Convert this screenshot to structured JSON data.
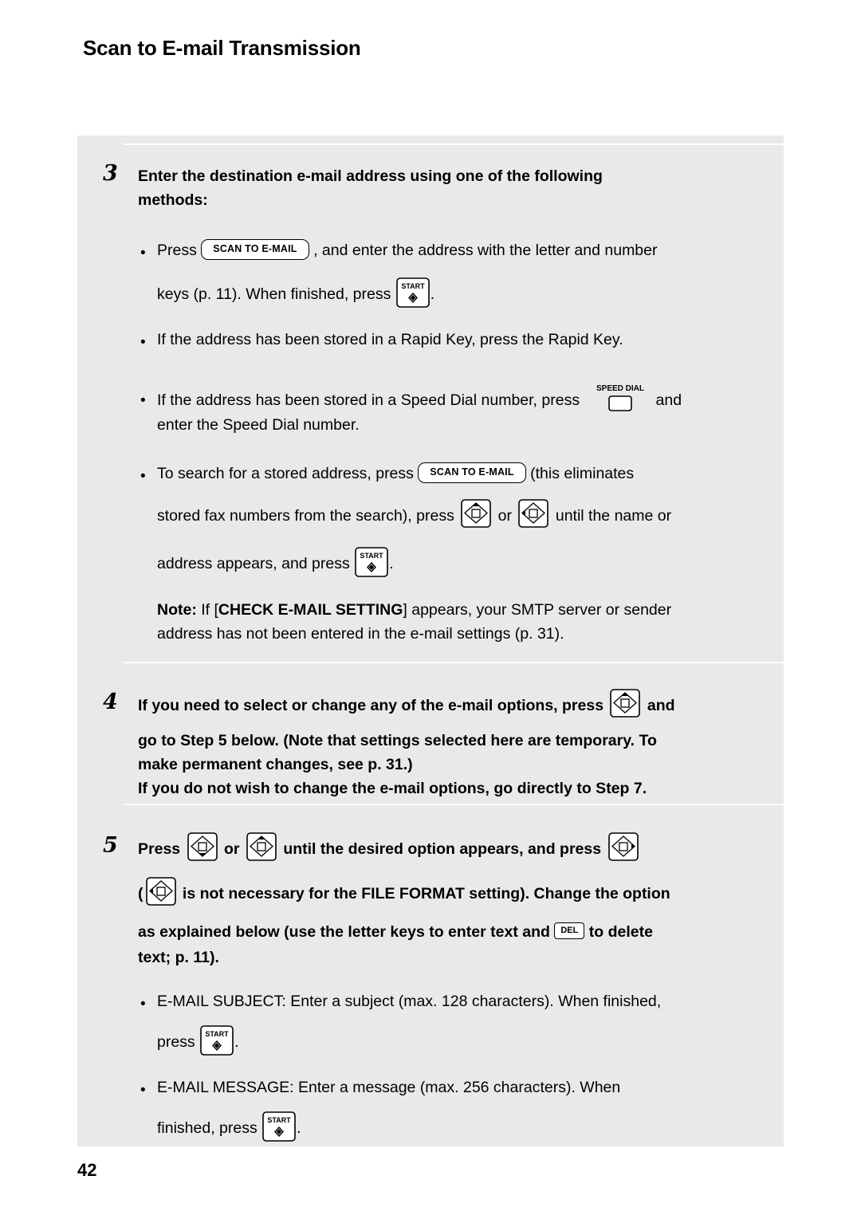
{
  "document": {
    "header_title": "Scan to E-mail Transmission",
    "page_number": "42"
  },
  "steps": [
    {
      "number": "3",
      "heading_line1": "Enter the destination e-mail address using one of the following",
      "heading_line2": "methods:",
      "bullets": [
        {
          "seg1": "Press",
          "key1": "SCAN TO E-MAIL",
          "seg2": ", and enter the address with the letter and number",
          "seg3": "keys (p. 11). When finished, press",
          "key2": "START",
          "seg4": "."
        },
        {
          "seg1": "If the address has been stored in a Rapid Key, press the Rapid Key."
        },
        {
          "seg1": "If the address has been stored in a Speed Dial number, press",
          "key1": "SPEED DIAL",
          "seg2": "and",
          "seg3": "enter the Speed Dial number."
        },
        {
          "seg1": "To search for a stored address, press",
          "key1": "SCAN TO E-MAIL",
          "seg2": "(this eliminates",
          "seg3": "stored fax numbers from the search), press",
          "seg4": "or",
          "seg5": "until the name or",
          "seg6": "address appears, and press",
          "key2": "START",
          "seg7": "."
        }
      ],
      "note": {
        "label": "Note:",
        "seg1": "If [",
        "emphasis": "CHECK E-MAIL SETTING",
        "seg2": "] appears, your SMTP server or sender",
        "seg3": "address has not been entered in the e-mail settings (p. 31)."
      }
    },
    {
      "number": "4",
      "line1_a": "If you need to select or change any of the e-mail options, press",
      "line1_b": "and",
      "line2": "go to Step 5 below. (Note that settings selected here are temporary. To",
      "line3": "make permanent changes, see p. 31.)",
      "line4": "If you do not wish to change the e-mail options, go directly to Step 7."
    },
    {
      "number": "5",
      "line1_a": "Press",
      "line1_b": "or",
      "line1_c": "until the desired option appears, and press",
      "line2_a": "(",
      "line2_b": "is not necessary for the FILE FORMAT setting). Change the option",
      "line3_a": "as explained below (use the letter keys to enter text and",
      "line3_key": "DEL",
      "line3_b": "to delete",
      "line4": "text; p. 11).",
      "bullets": [
        {
          "seg1": "E-MAIL SUBJECT: Enter a subject (max. 128 characters). When finished,",
          "seg2": "press",
          "key1": "START",
          "seg3": "."
        },
        {
          "seg1": "E-MAIL MESSAGE: Enter a message (max. 256 characters). When",
          "seg2": "finished, press",
          "key1": "START",
          "seg3": "."
        }
      ]
    }
  ],
  "icons": {
    "start_key_label": "START",
    "speed_dial_label": "SPEED DIAL",
    "bullet_glyph": "•"
  }
}
